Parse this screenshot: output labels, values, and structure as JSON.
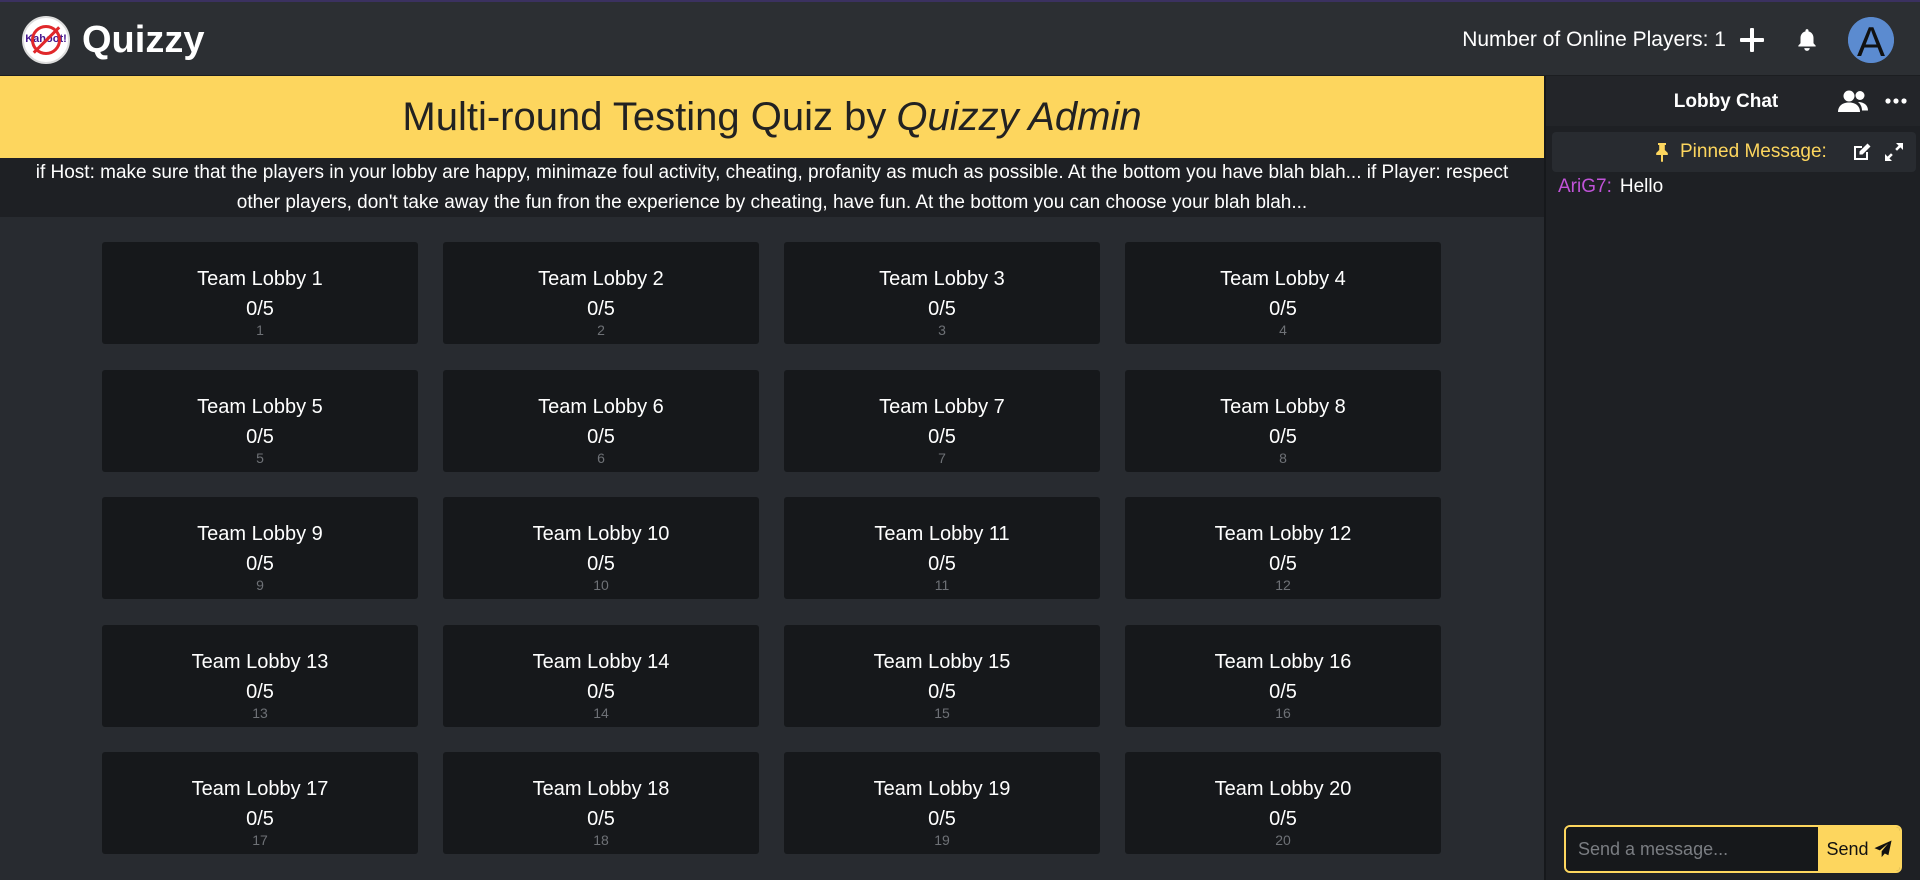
{
  "app": {
    "name": "Quizzy",
    "logo_text": "Kahoot!"
  },
  "header": {
    "online_label": "Number of Online Players: 1",
    "icons": [
      "plus-icon",
      "bell-icon",
      "avatar"
    ],
    "avatar_letter": "A"
  },
  "banner": {
    "title_prefix": "Multi-round Testing Quiz by",
    "author": "Quizzy Admin"
  },
  "description": "if Host: make sure that the players in your lobby are happy, minimaze foul activity, cheating, profanity as much as possible. At the bottom you have blah blah... if Player: respect other players, don't take away the fun fron the experience by cheating, have fun. At the bottom you can choose your blah blah...",
  "lobbies": [
    {
      "name": "Team Lobby 1",
      "count": "0/5",
      "index": "1"
    },
    {
      "name": "Team Lobby 2",
      "count": "0/5",
      "index": "2"
    },
    {
      "name": "Team Lobby 3",
      "count": "0/5",
      "index": "3"
    },
    {
      "name": "Team Lobby 4",
      "count": "0/5",
      "index": "4"
    },
    {
      "name": "Team Lobby 5",
      "count": "0/5",
      "index": "5"
    },
    {
      "name": "Team Lobby 6",
      "count": "0/5",
      "index": "6"
    },
    {
      "name": "Team Lobby 7",
      "count": "0/5",
      "index": "7"
    },
    {
      "name": "Team Lobby 8",
      "count": "0/5",
      "index": "8"
    },
    {
      "name": "Team Lobby 9",
      "count": "0/5",
      "index": "9"
    },
    {
      "name": "Team Lobby 10",
      "count": "0/5",
      "index": "10"
    },
    {
      "name": "Team Lobby 11",
      "count": "0/5",
      "index": "11"
    },
    {
      "name": "Team Lobby 12",
      "count": "0/5",
      "index": "12"
    },
    {
      "name": "Team Lobby 13",
      "count": "0/5",
      "index": "13"
    },
    {
      "name": "Team Lobby 14",
      "count": "0/5",
      "index": "14"
    },
    {
      "name": "Team Lobby 15",
      "count": "0/5",
      "index": "15"
    },
    {
      "name": "Team Lobby 16",
      "count": "0/5",
      "index": "16"
    },
    {
      "name": "Team Lobby 17",
      "count": "0/5",
      "index": "17"
    },
    {
      "name": "Team Lobby 18",
      "count": "0/5",
      "index": "18"
    },
    {
      "name": "Team Lobby 19",
      "count": "0/5",
      "index": "19"
    },
    {
      "name": "Team Lobby 20",
      "count": "0/5",
      "index": "20"
    }
  ],
  "chat": {
    "title": "Lobby Chat",
    "pinned_label": "Pinned Message:",
    "messages": [
      {
        "user": "AriG7:",
        "text": "Hello"
      }
    ],
    "input_placeholder": "Send a message...",
    "send_label": "Send"
  },
  "colors": {
    "accent_yellow": "#fdd65e",
    "username_purple": "#c053d8",
    "avatar_blue": "#5b8bd0"
  }
}
